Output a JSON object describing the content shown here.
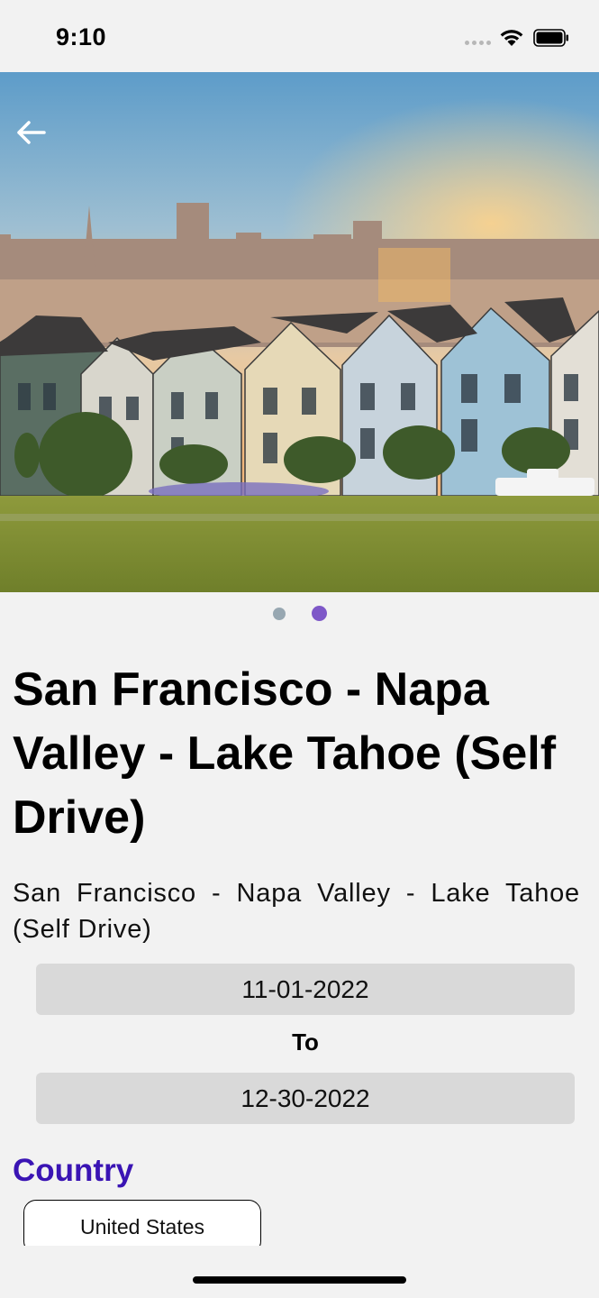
{
  "status_bar": {
    "time": "9:10"
  },
  "icons": {
    "back": "arrow-left-icon",
    "signal": "signal-dots-icon",
    "wifi": "wifi-icon",
    "battery": "battery-icon"
  },
  "carousel": {
    "total": 2,
    "active": 2
  },
  "package": {
    "title": "San Francisco - Napa Valley - Lake Tahoe (Self Drive)",
    "description": "San Francisco - Napa Valley - Lake Tahoe (Self Drive)"
  },
  "dates": {
    "from": "11-01-2022",
    "separator": "To",
    "to": "12-30-2022"
  },
  "country": {
    "heading": "Country",
    "value": "United States"
  },
  "colors": {
    "accent": "#3a14b4",
    "active_dot": "#7e58c8",
    "inactive_dot": "#97a7b1",
    "field_bg": "#d9d9d9"
  }
}
